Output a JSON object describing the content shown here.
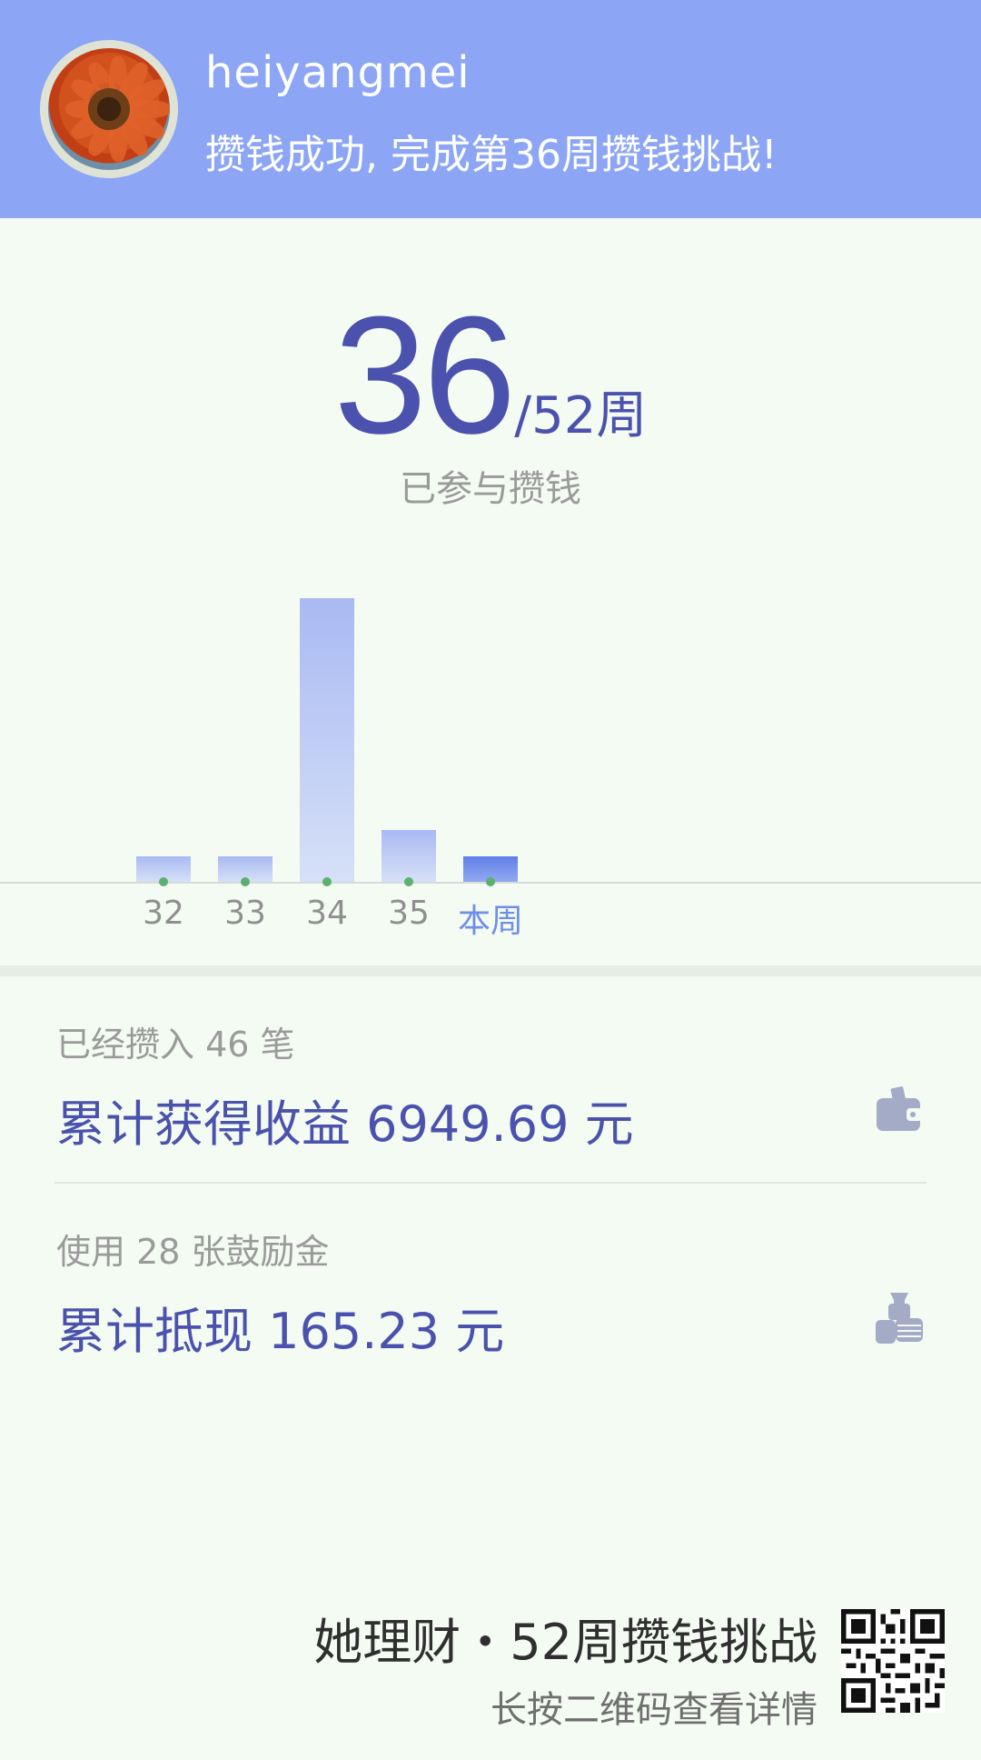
{
  "header": {
    "username": "heiyangmei",
    "message": "攒钱成功, 完成第36周攒钱挑战!"
  },
  "progress": {
    "weeks_done": "36",
    "weeks_total_label": "/52周",
    "caption": "已参与攒钱"
  },
  "chart_data": {
    "type": "bar",
    "categories": [
      "32",
      "33",
      "34",
      "35",
      "本周"
    ],
    "values": [
      1,
      1,
      11,
      2,
      1
    ],
    "highlight": "本周",
    "colors": {
      "bar": "#a9baf3",
      "current": "#6f8fe8",
      "dot": "#5bb06f"
    }
  },
  "stats": {
    "deposits_text": "已经攒入 46 笔",
    "earnings_text": "累计获得收益 6949.69 元",
    "earnings_icon": "wallet-icon",
    "coupons_text": "使用 28 张鼓励金",
    "cashback_text": "累计抵现 165.23 元",
    "cashback_icon": "money-hand-icon"
  },
  "footer": {
    "title": "她理财・52周攒钱挑战",
    "hint": "长按二维码查看详情"
  },
  "colors": {
    "header_bg": "#8ca6f5",
    "accent": "#4a52ad",
    "page_bg": "#f4fbf3"
  }
}
